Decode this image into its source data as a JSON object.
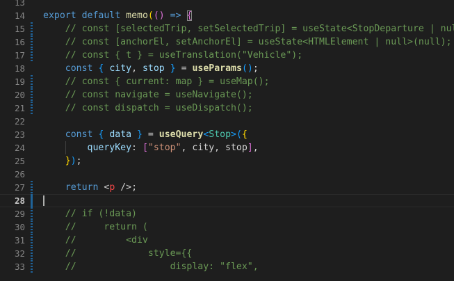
{
  "lines": [
    {
      "num": "13",
      "tokens": [],
      "mod": null
    },
    {
      "num": "14",
      "tokens": [
        {
          "t": "export",
          "c": "kw"
        },
        {
          "t": " ",
          "c": "plain"
        },
        {
          "t": "default",
          "c": "kw"
        },
        {
          "t": " ",
          "c": "plain"
        },
        {
          "t": "memo",
          "c": "fn"
        },
        {
          "t": "(",
          "c": "p1"
        },
        {
          "t": "()",
          "c": "p2"
        },
        {
          "t": " => ",
          "c": "kw"
        },
        {
          "t": "{",
          "c": "p2"
        }
      ],
      "mod": null
    },
    {
      "num": "15",
      "tokens": [
        {
          "t": "    // const [selectedTrip, setSelectedTrip] = useState<StopDeparture | null>(",
          "c": "cm"
        }
      ],
      "mod": "hatched"
    },
    {
      "num": "16",
      "tokens": [
        {
          "t": "    // const [anchorEl, setAnchorEl] = useState<HTMLElement | null>(null);",
          "c": "cm"
        }
      ],
      "mod": "hatched"
    },
    {
      "num": "17",
      "tokens": [
        {
          "t": "    // const { t } = useTranslation(\"Vehicle\");",
          "c": "cm"
        }
      ],
      "mod": "hatched"
    },
    {
      "num": "18",
      "tokens": [
        {
          "t": "    ",
          "c": "plain"
        },
        {
          "t": "const",
          "c": "kw"
        },
        {
          "t": " ",
          "c": "plain"
        },
        {
          "t": "{",
          "c": "p3"
        },
        {
          "t": " city",
          "c": "var"
        },
        {
          "t": ", ",
          "c": "plain"
        },
        {
          "t": "stop",
          "c": "var"
        },
        {
          "t": " ",
          "c": "plain"
        },
        {
          "t": "}",
          "c": "p3"
        },
        {
          "t": " = ",
          "c": "plain"
        },
        {
          "t": "useParams",
          "c": "fnb"
        },
        {
          "t": "()",
          "c": "p3"
        },
        {
          "t": ";",
          "c": "plain"
        }
      ],
      "mod": null
    },
    {
      "num": "19",
      "tokens": [
        {
          "t": "    // const { current: map } = useMap();",
          "c": "cm"
        }
      ],
      "mod": "hatched"
    },
    {
      "num": "20",
      "tokens": [
        {
          "t": "    // const navigate = useNavigate();",
          "c": "cm"
        }
      ],
      "mod": "hatched"
    },
    {
      "num": "21",
      "tokens": [
        {
          "t": "    // const dispatch = useDispatch();",
          "c": "cm"
        }
      ],
      "mod": "hatched"
    },
    {
      "num": "22",
      "tokens": [],
      "mod": null
    },
    {
      "num": "23",
      "tokens": [
        {
          "t": "    ",
          "c": "plain"
        },
        {
          "t": "const",
          "c": "kw"
        },
        {
          "t": " ",
          "c": "plain"
        },
        {
          "t": "{",
          "c": "p3"
        },
        {
          "t": " data ",
          "c": "var"
        },
        {
          "t": "}",
          "c": "p3"
        },
        {
          "t": " = ",
          "c": "plain"
        },
        {
          "t": "useQuery",
          "c": "fnb"
        },
        {
          "t": "<",
          "c": "p3"
        },
        {
          "t": "Stop",
          "c": "type"
        },
        {
          "t": ">",
          "c": "p3"
        },
        {
          "t": "(",
          "c": "p3"
        },
        {
          "t": "{",
          "c": "p1"
        }
      ],
      "mod": null
    },
    {
      "num": "24",
      "tokens": [
        {
          "t": "        queryKey",
          "c": "var"
        },
        {
          "t": ": ",
          "c": "plain"
        },
        {
          "t": "[",
          "c": "p2"
        },
        {
          "t": "\"stop\"",
          "c": "str"
        },
        {
          "t": ", city, stop",
          "c": "plain"
        },
        {
          "t": "]",
          "c": "p2"
        },
        {
          "t": ",",
          "c": "plain"
        }
      ],
      "mod": null
    },
    {
      "num": "25",
      "tokens": [
        {
          "t": "    ",
          "c": "plain"
        },
        {
          "t": "}",
          "c": "p1"
        },
        {
          "t": ")",
          "c": "p3"
        },
        {
          "t": ";",
          "c": "plain"
        }
      ],
      "mod": null
    },
    {
      "num": "26",
      "tokens": [],
      "mod": null
    },
    {
      "num": "27",
      "tokens": [
        {
          "t": "    ",
          "c": "plain"
        },
        {
          "t": "return",
          "c": "kw"
        },
        {
          "t": " ",
          "c": "plain"
        },
        {
          "t": "<",
          "c": "plain"
        },
        {
          "t": "p",
          "c": "tagname"
        },
        {
          "t": " />;",
          "c": "plain"
        }
      ],
      "mod": "hatched"
    },
    {
      "num": "28",
      "tokens": [],
      "mod": "solid",
      "current": true
    },
    {
      "num": "29",
      "tokens": [
        {
          "t": "    // if (!data)",
          "c": "cm"
        }
      ],
      "mod": "hatched"
    },
    {
      "num": "30",
      "tokens": [
        {
          "t": "    //     return (",
          "c": "cm"
        }
      ],
      "mod": "hatched"
    },
    {
      "num": "31",
      "tokens": [
        {
          "t": "    //         <div",
          "c": "cm"
        }
      ],
      "mod": "hatched"
    },
    {
      "num": "32",
      "tokens": [
        {
          "t": "    //             style={{",
          "c": "cm"
        }
      ],
      "mod": "hatched"
    },
    {
      "num": "33",
      "tokens": [
        {
          "t": "    //                 display: \"flex\",",
          "c": "cm"
        }
      ],
      "mod": "hatched"
    }
  ]
}
